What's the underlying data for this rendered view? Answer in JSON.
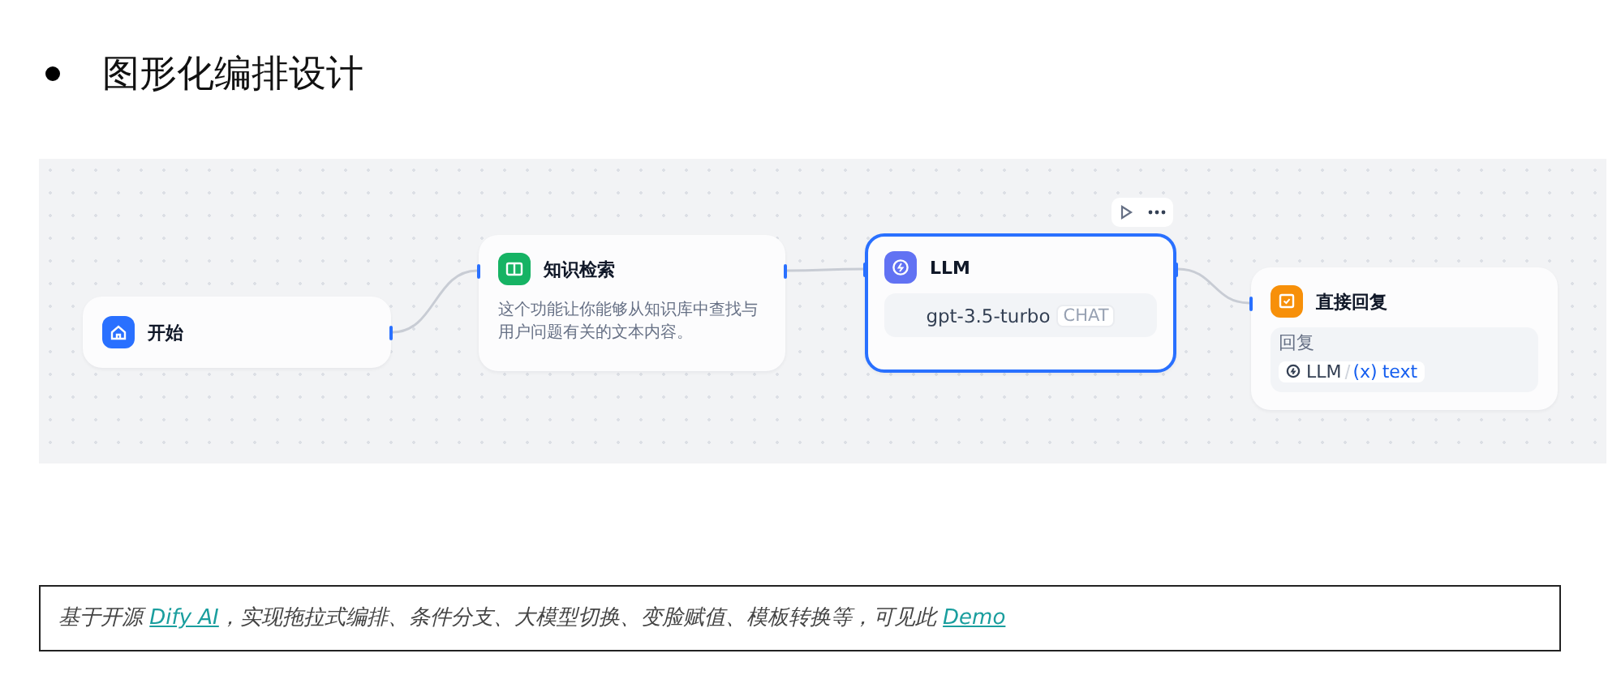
{
  "heading": "图形化编排设计",
  "nodes": [
    {
      "kind": "start",
      "title": "开始",
      "selected": false
    },
    {
      "kind": "knowledge",
      "title": "知识检索",
      "description": "这个功能让你能够从知识库中查找与用户问题有关的文本内容。",
      "selected": false
    },
    {
      "kind": "llm",
      "title": "LLM",
      "model": "gpt-3.5-turbo",
      "mode": "CHAT",
      "selected": true
    },
    {
      "kind": "answer",
      "title": "直接回复",
      "label": "回复",
      "source": "LLM",
      "variable_marker": "(x)",
      "variable": "text",
      "selected": false
    }
  ],
  "caption": [
    {
      "kind": "text",
      "text": "基于开源 "
    },
    {
      "kind": "link",
      "text": "Dify AI"
    },
    {
      "kind": "text",
      "text": "，实现拖拉式编排、条件分支、大模型切换、变脸赋值、模板转换等，可见此 "
    },
    {
      "kind": "link",
      "text": "Demo"
    }
  ]
}
